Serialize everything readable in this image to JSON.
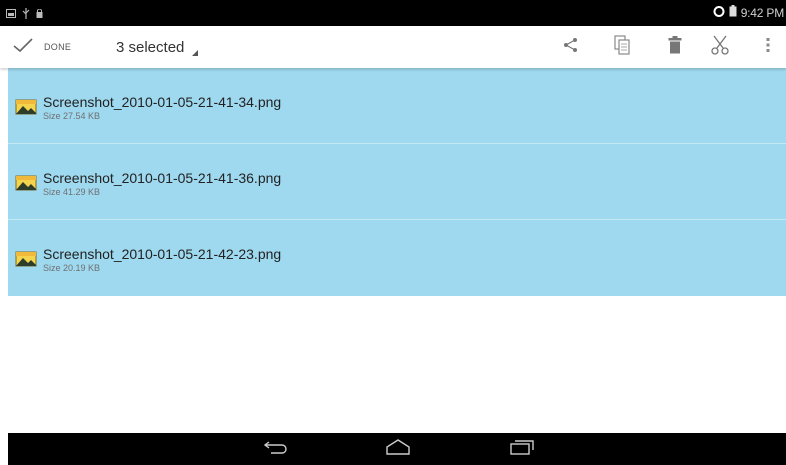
{
  "status_bar": {
    "time": "9:42 PM"
  },
  "action_bar": {
    "done_label": "DONE",
    "selected_label": "3 selected",
    "actions": [
      "share-icon",
      "copy-icon",
      "delete-icon",
      "cut-icon",
      "overflow-menu-icon"
    ]
  },
  "files": [
    {
      "name": "Screenshot_2010-01-05-21-41-34.png",
      "size": "Size 27.54 KB",
      "icon": "image-file-icon",
      "selected": true
    },
    {
      "name": "Screenshot_2010-01-05-21-41-36.png",
      "size": "Size 41.29 KB",
      "icon": "image-file-icon",
      "selected": true
    },
    {
      "name": "Screenshot_2010-01-05-21-42-23.png",
      "size": "Size 20.19 KB",
      "icon": "image-file-icon",
      "selected": true
    }
  ],
  "nav_bar": {
    "buttons": [
      "back-icon",
      "home-icon",
      "recent-apps-icon"
    ]
  },
  "colors": {
    "selection": "#9fd9ef",
    "status_bar": "#000000",
    "nav_bar": "#000000"
  }
}
